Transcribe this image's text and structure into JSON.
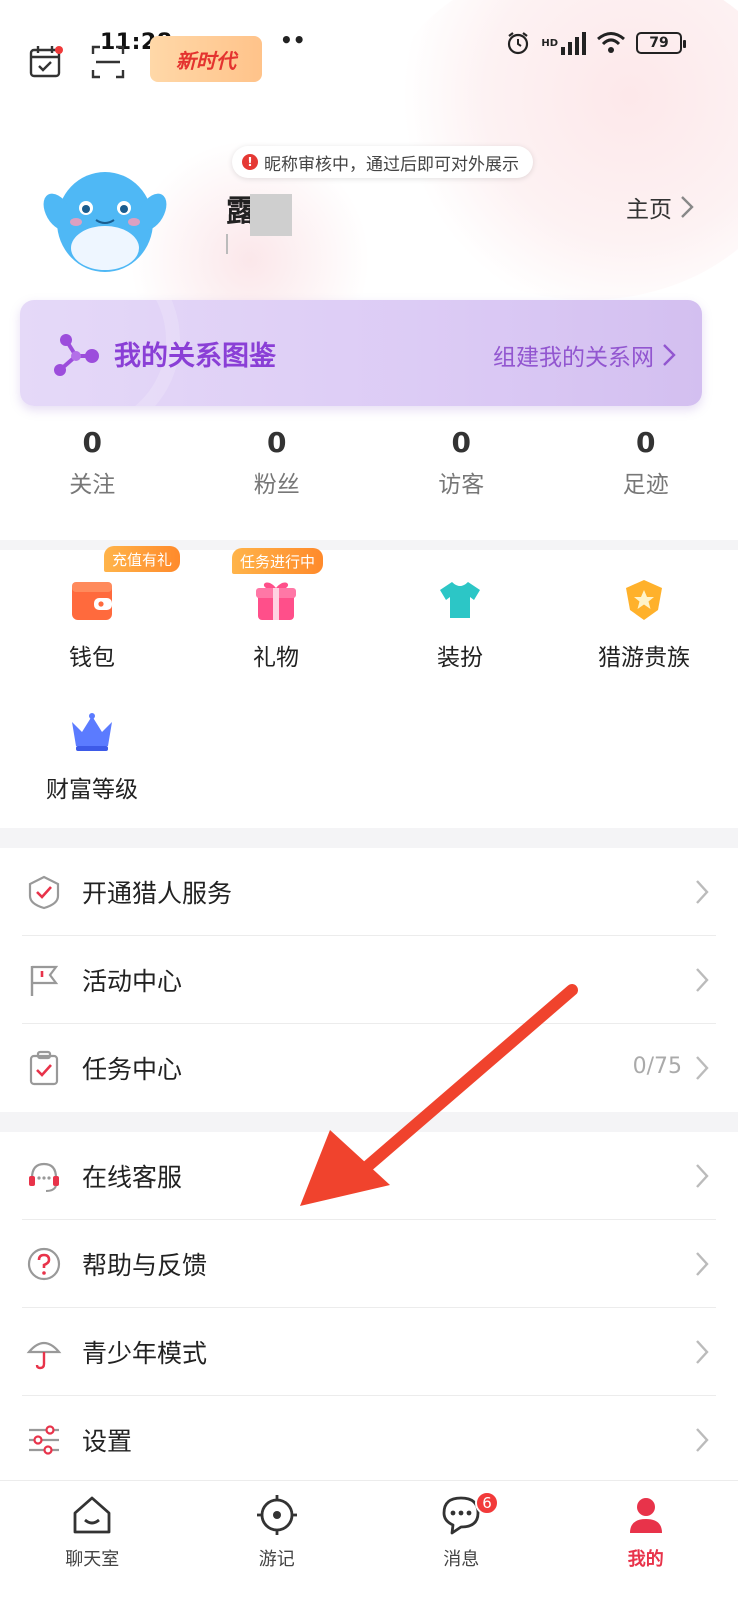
{
  "status_bar": {
    "time": "11:28",
    "dots": "••",
    "battery": "79",
    "hd_label": "HD"
  },
  "header": {
    "banner_text": "新时代"
  },
  "profile": {
    "nickname_notice": "昵称审核中，通过后即可对外展示",
    "nickname": "露",
    "home_link": "主页"
  },
  "relation_card": {
    "title": "我的关系图鉴",
    "link": "组建我的关系网"
  },
  "stats": [
    {
      "value": "0",
      "label": "关注"
    },
    {
      "value": "0",
      "label": "粉丝"
    },
    {
      "value": "0",
      "label": "访客"
    },
    {
      "value": "0",
      "label": "足迹"
    }
  ],
  "grid": [
    {
      "label": "钱包",
      "badge": "充值有礼",
      "icon": "wallet-icon",
      "color": "#ff6a3d"
    },
    {
      "label": "礼物",
      "badge": "任务进行中",
      "icon": "gift-icon",
      "color": "#ff4f8a"
    },
    {
      "label": "装扮",
      "badge": "",
      "icon": "tshirt-icon",
      "color": "#2cc6c6"
    },
    {
      "label": "猎游贵族",
      "badge": "",
      "icon": "noble-shield-icon",
      "color": "#ffb12b"
    },
    {
      "label": "财富等级",
      "badge": "",
      "icon": "crown-icon",
      "color": "#5b7bff"
    }
  ],
  "list_group_1": [
    {
      "label": "开通猎人服务",
      "value": "",
      "icon": "hunter-shield-icon"
    },
    {
      "label": "活动中心",
      "value": "",
      "icon": "flag-icon"
    },
    {
      "label": "任务中心",
      "value": "0/75",
      "icon": "clipboard-icon"
    }
  ],
  "list_group_2": [
    {
      "label": "在线客服",
      "value": "",
      "icon": "headset-icon"
    },
    {
      "label": "帮助与反馈",
      "value": "",
      "icon": "question-icon"
    },
    {
      "label": "青少年模式",
      "value": "",
      "icon": "umbrella-icon"
    },
    {
      "label": "设置",
      "value": "",
      "icon": "sliders-icon"
    }
  ],
  "bottom_nav": [
    {
      "label": "聊天室",
      "icon": "house-icon",
      "active": false
    },
    {
      "label": "游记",
      "icon": "target-icon",
      "active": false
    },
    {
      "label": "消息",
      "icon": "chat-bubble-icon",
      "active": false,
      "badge": "6"
    },
    {
      "label": "我的",
      "icon": "profile-icon",
      "active": true
    }
  ],
  "colors": {
    "accent": "#e8334a",
    "purple": "#8a3fd6",
    "arrow": "#f0432d"
  }
}
